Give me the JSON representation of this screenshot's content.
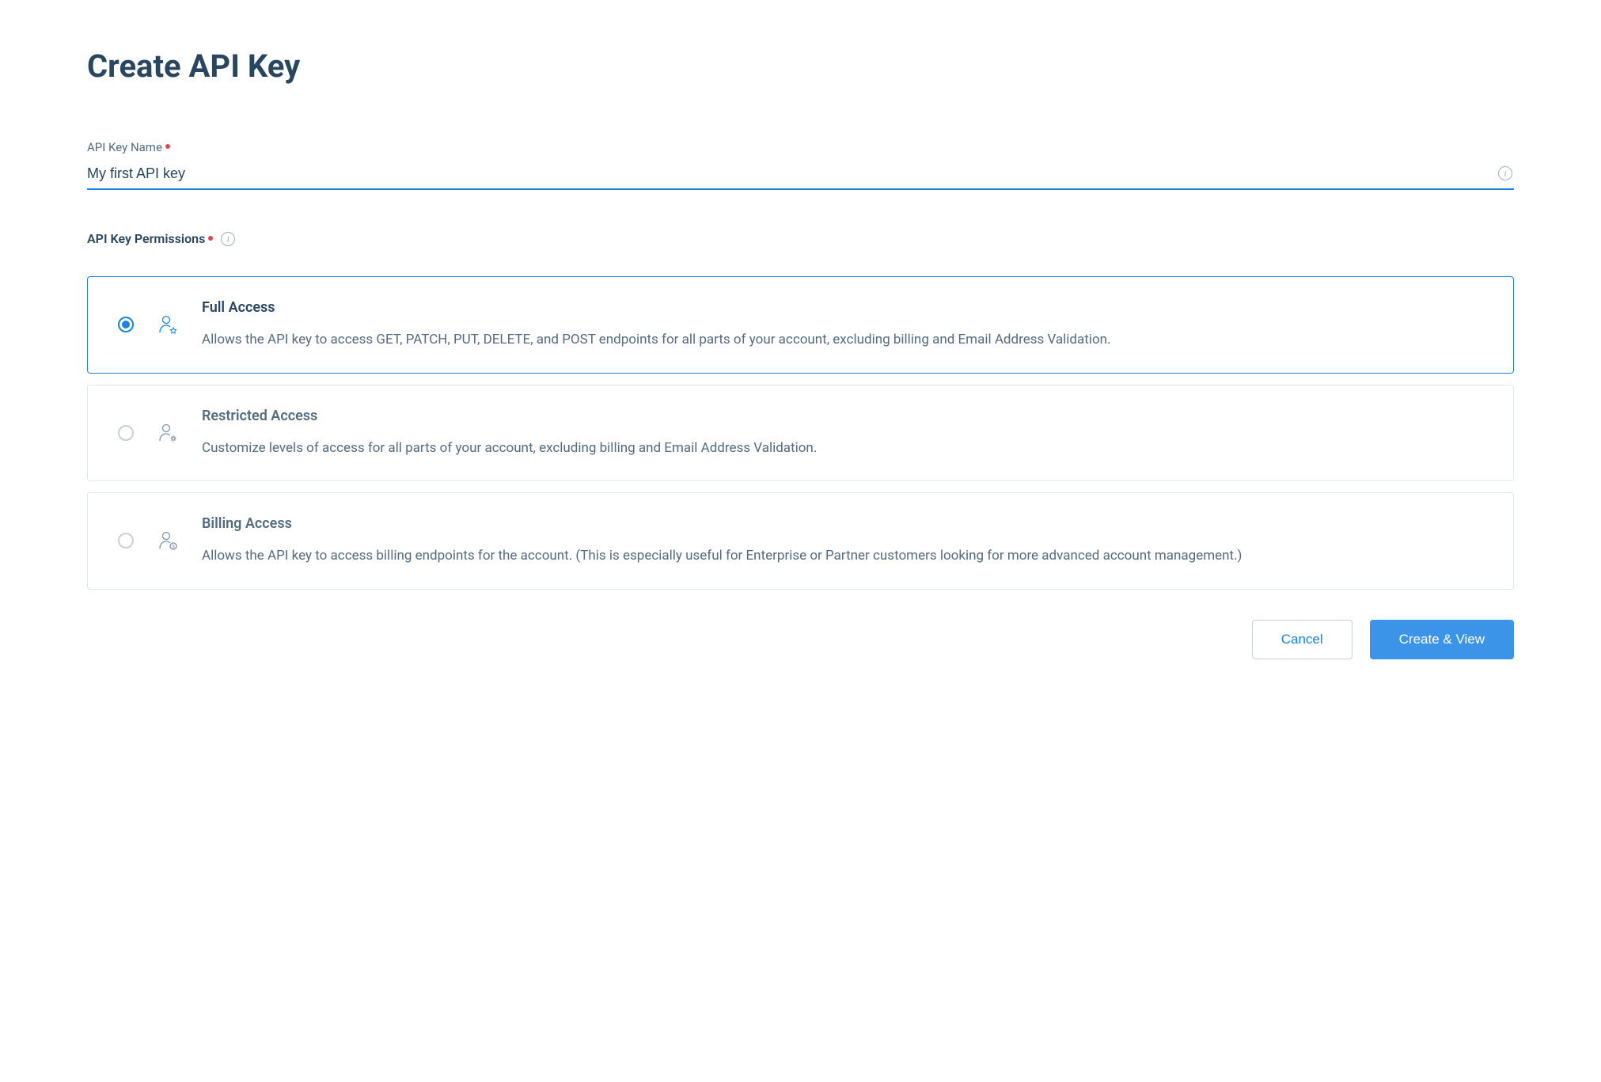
{
  "page_title": "Create API Key",
  "name_field": {
    "label": "API Key Name",
    "value": "My first API key"
  },
  "permissions": {
    "label": "API Key Permissions",
    "options": [
      {
        "title": "Full Access",
        "description": "Allows the API key to access GET, PATCH, PUT, DELETE, and POST endpoints for all parts of your account, excluding billing and Email Address Validation.",
        "selected": true,
        "icon": "user-star"
      },
      {
        "title": "Restricted Access",
        "description": "Customize levels of access for all parts of your account, excluding billing and Email Address Validation.",
        "selected": false,
        "icon": "user-gear"
      },
      {
        "title": "Billing Access",
        "description": "Allows the API key to access billing endpoints for the account. (This is especially useful for Enterprise or Partner customers looking for more advanced account management.)",
        "selected": false,
        "icon": "user-dollar"
      }
    ]
  },
  "buttons": {
    "cancel": "Cancel",
    "submit": "Create & View"
  }
}
